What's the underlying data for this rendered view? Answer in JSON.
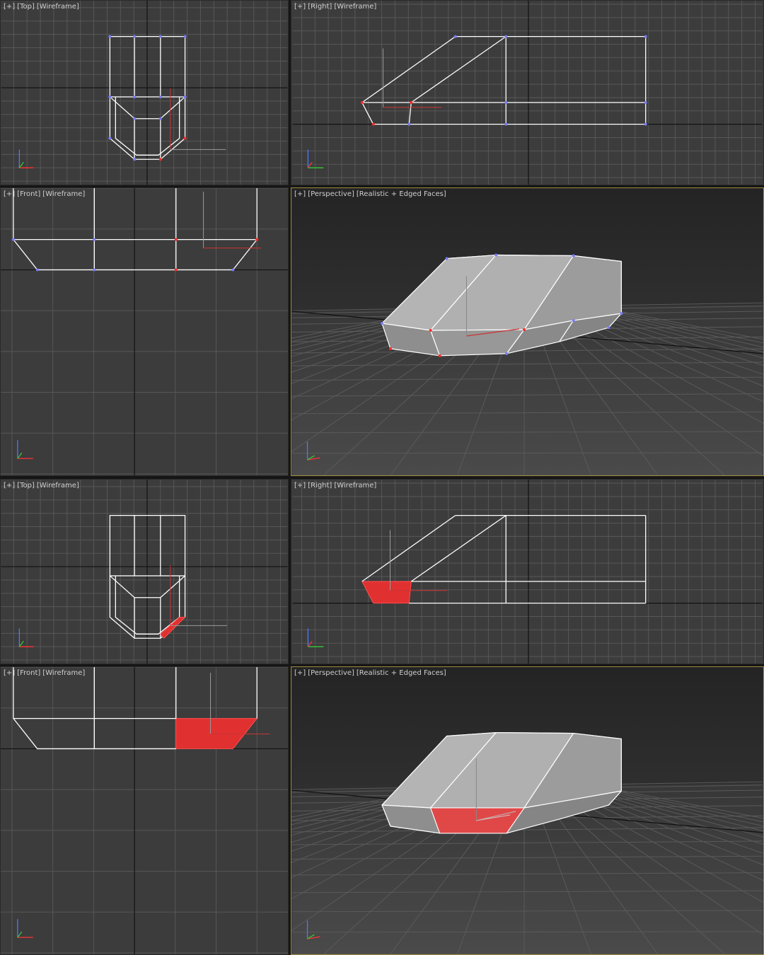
{
  "viewports": [
    {
      "id": "top-1",
      "menu": "[+]",
      "view": "[Top]",
      "mode": "[Wireframe]"
    },
    {
      "id": "right-1",
      "menu": "[+]",
      "view": "[Right]",
      "mode": "[Wireframe]"
    },
    {
      "id": "front-1",
      "menu": "[+]",
      "view": "[Front]",
      "mode": "[Wireframe]"
    },
    {
      "id": "persp-1",
      "menu": "[+]",
      "view": "[Perspective]",
      "mode": "[Realistic + Edged Faces]"
    },
    {
      "id": "top-2",
      "menu": "[+]",
      "view": "[Top]",
      "mode": "[Wireframe]"
    },
    {
      "id": "right-2",
      "menu": "[+]",
      "view": "[Right]",
      "mode": "[Wireframe]"
    },
    {
      "id": "front-2",
      "menu": "[+]",
      "view": "[Front]",
      "mode": "[Wireframe]"
    },
    {
      "id": "persp-2",
      "menu": "[+]",
      "view": "[Perspective]",
      "mode": "[Realistic + Edged Faces]"
    }
  ],
  "colors": {
    "viewport_bg": "#3c3c3c",
    "grid": "#575757",
    "grid_axis": "#111111",
    "wire": "#ffffff",
    "vertex": "#7b7bff",
    "vertex_selected": "#ff2a2a",
    "selected_face": "#e03030",
    "active_border": "#a08a3c"
  },
  "axis_letters": {
    "x": "x",
    "y": "y",
    "z": "z"
  }
}
